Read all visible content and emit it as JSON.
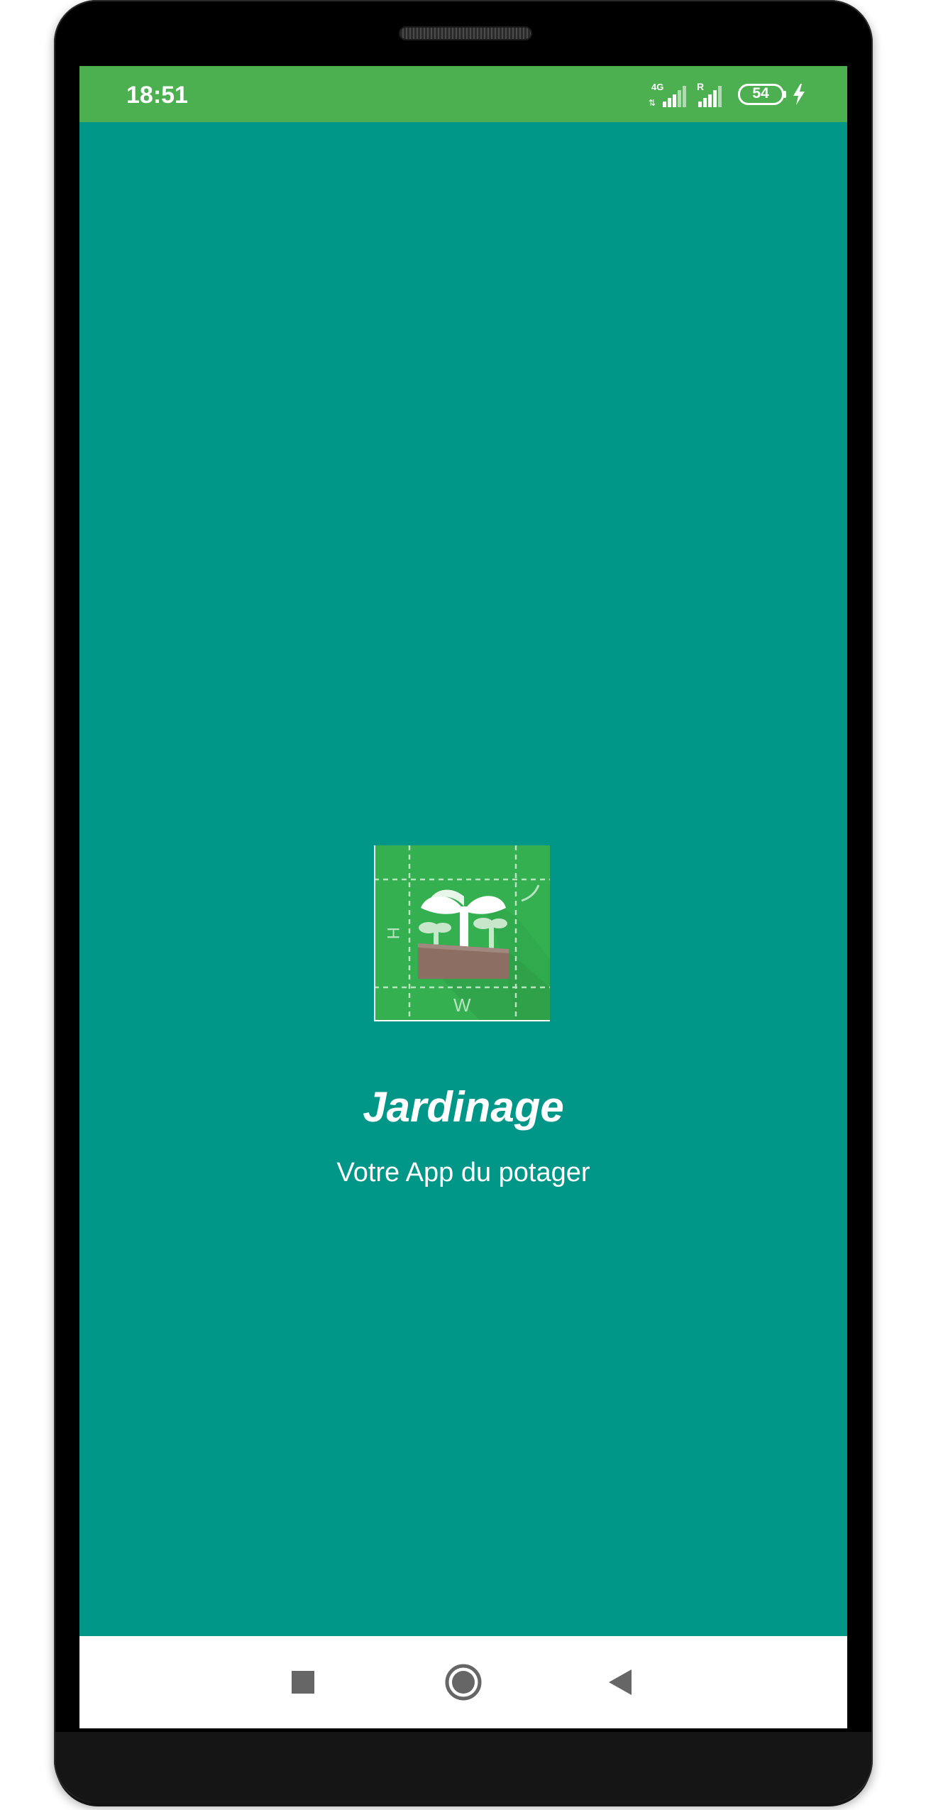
{
  "status_bar": {
    "time": "18:51",
    "network_type": "4G",
    "roaming_indicator": "R",
    "battery_level": "54",
    "charging": true,
    "color": "#4caf50"
  },
  "splash": {
    "background_color": "#009688",
    "logo": {
      "icon": "seedling-garden-plan-icon",
      "height_label": "H",
      "width_label": "W"
    },
    "title": "Jardinage",
    "subtitle": "Votre App du potager"
  },
  "nav_bar": {
    "recent_icon": "square-recent-apps-icon",
    "home_icon": "circle-home-icon",
    "back_icon": "triangle-back-icon"
  }
}
